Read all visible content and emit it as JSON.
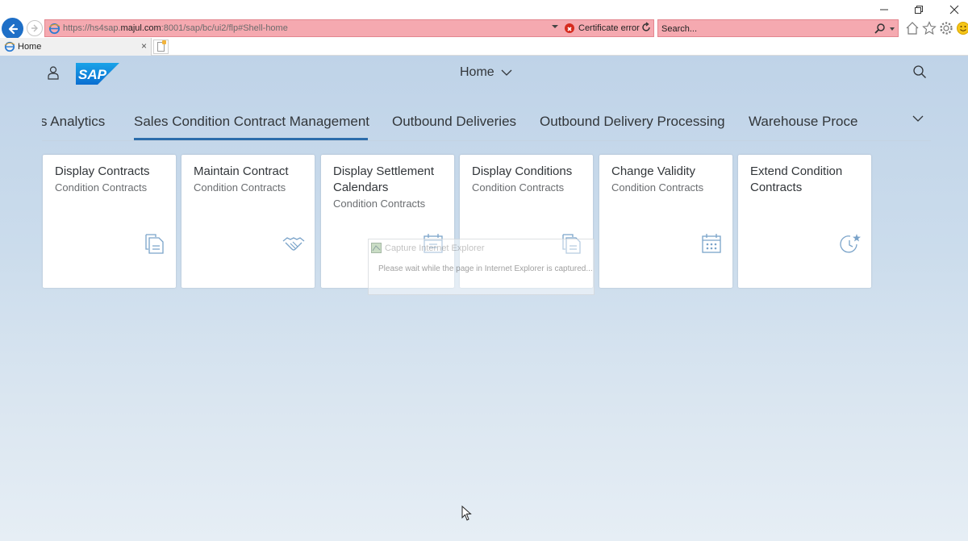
{
  "browser": {
    "url_prefix": "https://hs4sap.",
    "url_domain": "majul.com",
    "url_suffix": ":8001/sap/bc/ui2/flp#Shell-home",
    "cert_error": "Certificate error",
    "search_placeholder": "Search...",
    "tab_title": "Home",
    "tab_close": "×",
    "address_bar_color": "#f5a9b0"
  },
  "shell": {
    "title": "Home",
    "logo_text": "SAP",
    "brand_color": "#0a6ed1"
  },
  "anchor_bar": {
    "items": [
      {
        "label": "s Analytics",
        "active": false
      },
      {
        "label": "Sales Condition Contract Management",
        "active": true
      },
      {
        "label": "Outbound Deliveries",
        "active": false
      },
      {
        "label": "Outbound Delivery Processing",
        "active": false
      },
      {
        "label": "Warehouse Proce",
        "active": false
      }
    ],
    "active_underline_color": "#2b6cab"
  },
  "tiles": [
    {
      "title": "Display Contracts",
      "subtitle": "Condition Contracts",
      "icon": "document-icon"
    },
    {
      "title": "Maintain Contract",
      "subtitle": "Condition Contracts",
      "icon": "handshake-icon"
    },
    {
      "title": "Display Settlement Calendars",
      "subtitle": "Condition Contracts",
      "icon": "calendar-icon"
    },
    {
      "title": "Display Conditions",
      "subtitle": "Condition Contracts",
      "icon": "document-icon"
    },
    {
      "title": "Change Validity",
      "subtitle": "Condition Contracts",
      "icon": "calendar-icon"
    },
    {
      "title": "Extend Condition Contracts",
      "subtitle": "",
      "icon": "clock-star-icon"
    }
  ],
  "capture_overlay": {
    "title": "Capture Internet Explorer",
    "message": "Please wait while the page in Internet Explorer is captured..."
  }
}
